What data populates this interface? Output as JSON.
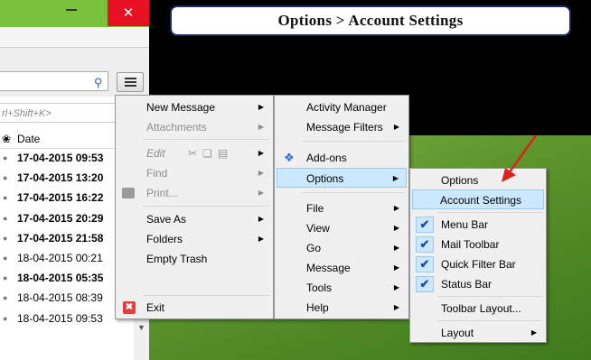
{
  "banner": {
    "text": "Options > Account Settings"
  },
  "window": {
    "close_glyph": "✕",
    "quickfilter_placeholder": "rl+Shift+K>",
    "columns": {
      "date": "Date"
    },
    "messages": [
      {
        "date": "17-04-2015 09:53",
        "bold": true
      },
      {
        "date": "17-04-2015 13:20",
        "bold": true
      },
      {
        "date": "17-04-2015 16:22",
        "bold": true
      },
      {
        "date": "17-04-2015 20:29",
        "bold": true
      },
      {
        "date": "17-04-2015 21:58",
        "bold": true
      },
      {
        "date": "18-04-2015 00:21",
        "bold": false
      },
      {
        "date": "18-04-2015 05:35",
        "bold": true
      },
      {
        "date": "18-04-2015 08:39",
        "bold": false
      },
      {
        "date": "18-04-2015 09:53",
        "bold": false
      }
    ]
  },
  "menu_main": {
    "items": [
      {
        "label": "New Message"
      },
      {
        "label": "Attachments"
      },
      {
        "label": "Edit"
      },
      {
        "label": "Find"
      },
      {
        "label": "Print..."
      },
      {
        "label": "Save As"
      },
      {
        "label": "Folders"
      },
      {
        "label": "Empty Trash"
      },
      {
        "label": "Exit"
      }
    ]
  },
  "menu_secondary": {
    "items": [
      {
        "label": "Activity Manager"
      },
      {
        "label": "Message Filters"
      },
      {
        "label": "Add-ons"
      },
      {
        "label": "Options"
      },
      {
        "label": "File"
      },
      {
        "label": "View"
      },
      {
        "label": "Go"
      },
      {
        "label": "Message"
      },
      {
        "label": "Tools"
      },
      {
        "label": "Help"
      }
    ]
  },
  "menu_options": {
    "items": [
      {
        "label": "Options"
      },
      {
        "label": "Account Settings"
      },
      {
        "label": "Menu Bar"
      },
      {
        "label": "Mail Toolbar"
      },
      {
        "label": "Quick Filter Bar"
      },
      {
        "label": "Status Bar"
      },
      {
        "label": "Toolbar Layout..."
      },
      {
        "label": "Layout"
      }
    ]
  },
  "colors": {
    "highlight": "#cce8ff",
    "titlebar": "#79c23d",
    "close": "#e81123",
    "arrow": "#e02020"
  }
}
